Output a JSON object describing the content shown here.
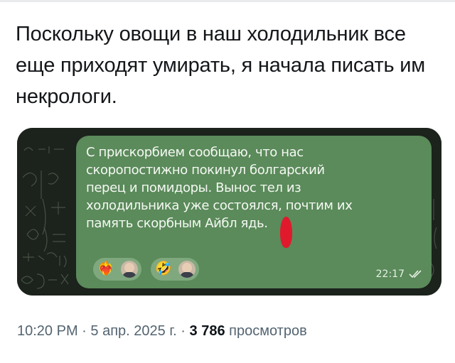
{
  "post": {
    "text": "Поскольку овощи в наш холодильник все еще приходят умирать, я начала писать им некрологи.",
    "time": "10:20 PM",
    "separator": "·",
    "date": "5 апр. 2025 г.",
    "views_count": "3 786",
    "views_label": "просмотров"
  },
  "message": {
    "text": "С прискорбием сообщаю, что нас\nскоропостижно покинул болгарский\nперец и помидоры. Вынос тел из\nхолодильника уже состоялся, почтим их\nпамять скорбным Айбл ядь.",
    "time": "22:17",
    "status_icon": "double-check-icon",
    "bubble_color": "#5b8a5b",
    "reactions": [
      {
        "emoji": "❤️‍🔥",
        "icon": "heart-on-fire-icon",
        "avatar": "user-avatar"
      },
      {
        "emoji": "🤣",
        "icon": "rolling-laughing-icon",
        "avatar": "user-avatar"
      }
    ]
  },
  "colors": {
    "text": "#14171a",
    "meta": "#536471",
    "chalkboard": "#1c221c"
  }
}
